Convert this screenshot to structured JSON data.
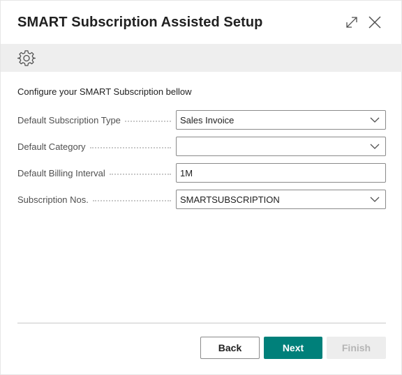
{
  "dialog": {
    "title": "SMART Subscription Assisted Setup",
    "instruction": "Configure your SMART Subscription bellow"
  },
  "icons": {
    "expand": "expand-icon",
    "close": "close-icon",
    "settings": "gear-icon",
    "dropdown": "chevron-down-icon"
  },
  "fields": [
    {
      "label": "Default Subscription Type",
      "value": "Sales Invoice",
      "type": "select"
    },
    {
      "label": "Default Category",
      "value": "",
      "type": "select"
    },
    {
      "label": "Default Billing Interval",
      "value": "1M",
      "type": "text"
    },
    {
      "label": "Subscription Nos.",
      "value": "SMARTSUBSCRIPTION",
      "type": "select"
    }
  ],
  "buttons": {
    "back": "Back",
    "next": "Next",
    "finish": "Finish"
  },
  "colors": {
    "primary": "#00807a",
    "toolbar_bg": "#eeeeee",
    "disabled_bg": "#ededed",
    "disabled_text": "#b5b5b5"
  }
}
